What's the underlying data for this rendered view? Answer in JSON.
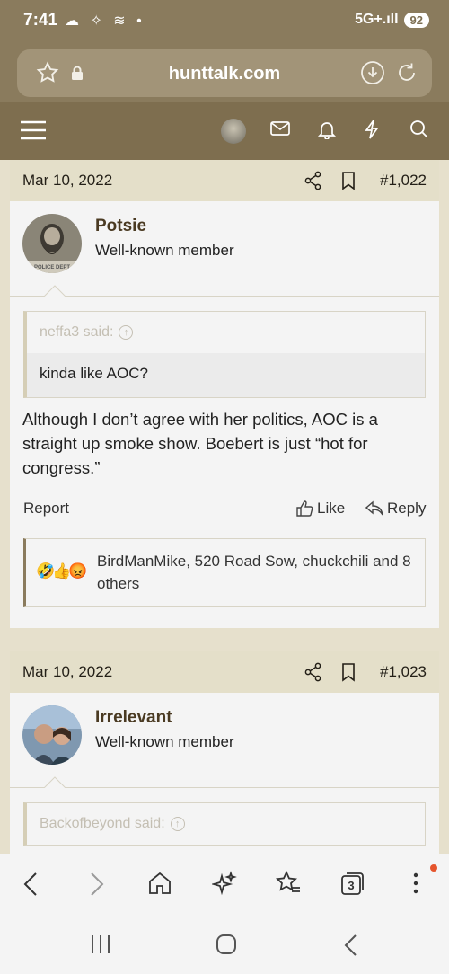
{
  "status_bar": {
    "time": "7:41",
    "left_icons": "☁ ✧ ≋ •",
    "network": "5G+.ıll",
    "battery": "92"
  },
  "browser": {
    "url": "hunttalk.com",
    "tab_count": "3"
  },
  "posts": [
    {
      "date": "Mar 10, 2022",
      "number": "#1,022",
      "username": "Potsie",
      "user_title": "Well-known member",
      "avatar_text": "POLICE DEPT",
      "quote": {
        "author": "neffa3 said:",
        "text": "kinda like AOC?"
      },
      "body": "Although I don’t agree with her politics, AOC is a straight up smoke show. Boebert is just “hot for congress.”",
      "report_label": "Report",
      "like_label": "Like",
      "reply_label": "Reply",
      "reactions_emoji": "🤣👍😡",
      "reactions_text": "BirdManMike, 520 Road Sow, chuckchili and 8 others"
    },
    {
      "date": "Mar 10, 2022",
      "number": "#1,023",
      "username": "Irrelevant",
      "user_title": "Well-known member",
      "quote": {
        "author": "Backofbeyond said:"
      }
    }
  ],
  "colors": {
    "header_bg": "#8a7b5d",
    "nav_bg": "#7e6e4f",
    "post_head_bg": "#e4dfc9",
    "username": "#4a3a22"
  }
}
